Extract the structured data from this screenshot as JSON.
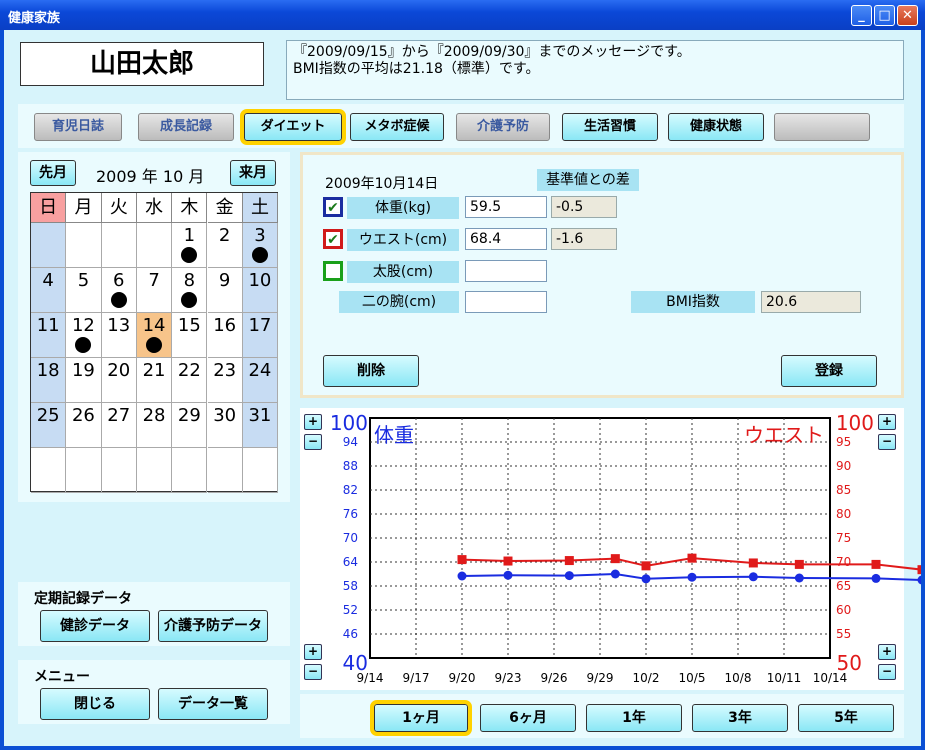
{
  "window": {
    "title": "健康家族",
    "min": "_",
    "max": "□",
    "close": "✕"
  },
  "user_name": "山田太郎",
  "message": {
    "line1": "『2009/09/15』から『2009/09/30』までのメッセージです。",
    "line2": "BMI指数の平均は21.18（標準）です。"
  },
  "tabs": [
    {
      "label": "育児日誌"
    },
    {
      "label": "成長記録"
    },
    {
      "label": "ダイエット"
    },
    {
      "label": "メタボ症候"
    },
    {
      "label": "介護予防"
    },
    {
      "label": "生活習慣"
    },
    {
      "label": "健康状態"
    },
    {
      "label": ""
    }
  ],
  "calendar": {
    "prev": "先月",
    "next": "来月",
    "title": "2009 年 10 月",
    "weekdays": [
      "日",
      "月",
      "火",
      "水",
      "木",
      "金",
      "土"
    ],
    "weeks": [
      [
        "",
        "",
        "",
        "",
        "1",
        "2",
        "3"
      ],
      [
        "4",
        "5",
        "6",
        "7",
        "8",
        "9",
        "10"
      ],
      [
        "11",
        "12",
        "13",
        "14",
        "15",
        "16",
        "17"
      ],
      [
        "18",
        "19",
        "20",
        "21",
        "22",
        "23",
        "24"
      ],
      [
        "25",
        "26",
        "27",
        "28",
        "29",
        "30",
        "31"
      ],
      [
        "",
        "",
        "",
        "",
        "",
        "",
        ""
      ]
    ],
    "marked_days": [
      "1",
      "3",
      "6",
      "8",
      "12",
      "14"
    ],
    "selected_day": "14"
  },
  "form": {
    "date": "2009年10月14日",
    "diff_header": "基準値との差",
    "weight_label": "体重(kg)",
    "weight_value": "59.5",
    "weight_diff": "-0.5",
    "waist_label": "ウエスト(cm)",
    "waist_value": "68.4",
    "waist_diff": "-1.6",
    "thigh_label": "太股(cm)",
    "thigh_value": "",
    "arm_label": "二の腕(cm)",
    "arm_value": "",
    "bmi_label": "BMI指数",
    "bmi_value": "20.6",
    "delete": "削除",
    "register": "登録",
    "weight_check": "✔",
    "waist_check": "✔"
  },
  "chart_data": {
    "type": "line",
    "title": "",
    "left_axis": {
      "label": "体重",
      "min": 40,
      "max": 100,
      "top_label": "100",
      "bottom_label": "40",
      "ticks": [
        94,
        88,
        82,
        76,
        70,
        64,
        58,
        52,
        46
      ]
    },
    "right_axis": {
      "label": "ウエスト",
      "min": 50,
      "max": 100,
      "top_label": "100",
      "bottom_label": "50",
      "ticks": [
        95,
        90,
        85,
        80,
        75,
        70,
        65,
        60,
        55
      ]
    },
    "x_ticks": [
      "9/14",
      "9/17",
      "9/20",
      "9/23",
      "9/26",
      "9/29",
      "10/2",
      "10/5",
      "10/8",
      "10/11",
      "10/14"
    ],
    "grid": true,
    "series": [
      {
        "name": "体重",
        "axis": "left",
        "color": "#1a2ce0",
        "points": [
          [
            20,
            60.5
          ],
          [
            23,
            60.7
          ],
          [
            27,
            60.6
          ],
          [
            30,
            61.0
          ],
          [
            32,
            59.8
          ],
          [
            35,
            60.2
          ],
          [
            39,
            60.3
          ],
          [
            42,
            60.0
          ],
          [
            47,
            59.9
          ],
          [
            50,
            59.5
          ]
        ]
      },
      {
        "name": "ウエスト",
        "axis": "right",
        "color": "#e01a1a",
        "points": [
          [
            20,
            70.5
          ],
          [
            23,
            70.2
          ],
          [
            27,
            70.3
          ],
          [
            30,
            70.7
          ],
          [
            32,
            69.2
          ],
          [
            35,
            70.8
          ],
          [
            39,
            69.8
          ],
          [
            42,
            69.5
          ],
          [
            47,
            69.5
          ],
          [
            50,
            68.4
          ]
        ]
      }
    ]
  },
  "range_buttons": [
    "1ヶ月",
    "6ヶ月",
    "1年",
    "3年",
    "5年"
  ],
  "periodic": {
    "label": "定期記録データ",
    "checkup": "健診データ",
    "care": "介護予防データ"
  },
  "menu": {
    "label": "メニュー",
    "close": "閉じる",
    "list": "データ一覧"
  },
  "colors": {
    "accent_blue": "#1a2ce0",
    "accent_red": "#e01a1a",
    "highlight": "#ffd200",
    "selected_day": "#f7c48a",
    "weekend": "#c7dcf3",
    "sunday_header": "#f8a0a0"
  }
}
